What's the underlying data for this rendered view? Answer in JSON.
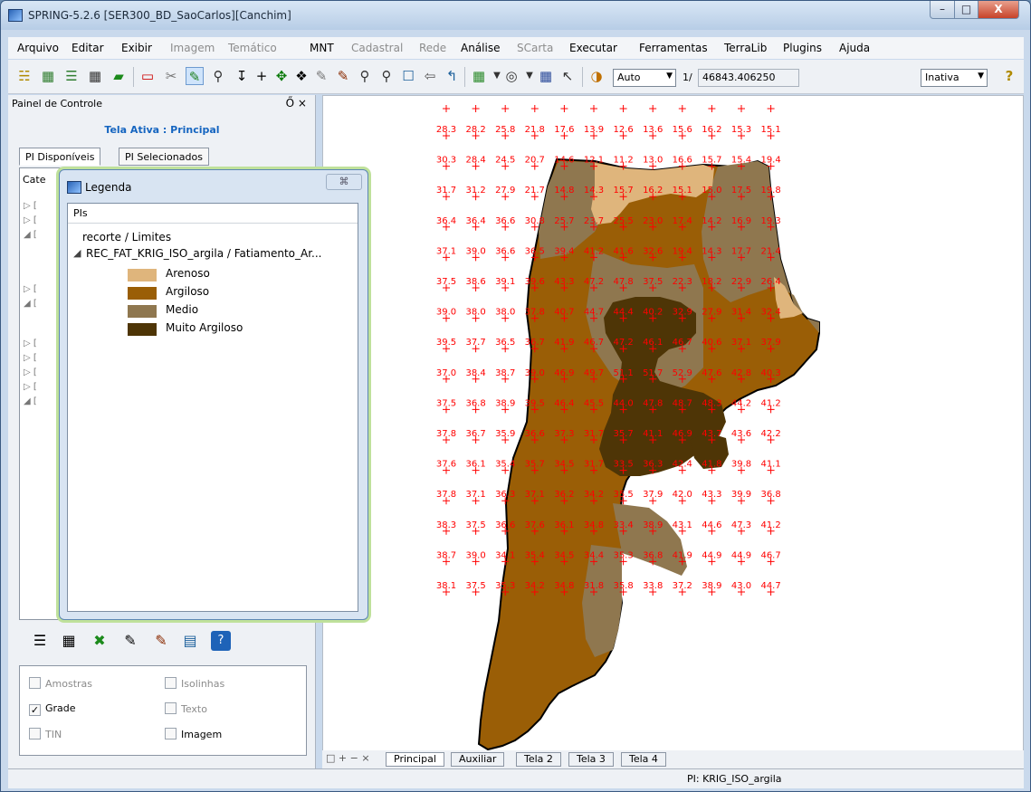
{
  "window": {
    "title": "SPRING-5.2.6 [SER300_BD_SaoCarlos][Canchim]",
    "min": "–",
    "max": "□",
    "close": "X"
  },
  "menu": [
    {
      "label": "Arquivo",
      "enabled": true
    },
    {
      "label": "Editar",
      "enabled": true
    },
    {
      "label": "Exibir",
      "enabled": true
    },
    {
      "label": "Imagem",
      "enabled": false
    },
    {
      "label": "Temático",
      "enabled": false
    },
    {
      "label": "MNT",
      "enabled": true
    },
    {
      "label": "Cadastral",
      "enabled": false
    },
    {
      "label": "Rede",
      "enabled": false
    },
    {
      "label": "Análise",
      "enabled": true
    },
    {
      "label": "SCarta",
      "enabled": false
    },
    {
      "label": "Executar",
      "enabled": true
    },
    {
      "label": "Ferramentas",
      "enabled": true
    },
    {
      "label": "TerraLib",
      "enabled": true
    },
    {
      "label": "Plugins",
      "enabled": true
    },
    {
      "label": "Ajuda",
      "enabled": true
    }
  ],
  "toolbar": {
    "zoom_mode": "Auto",
    "scale_prefix": "1/",
    "scale_value": "46843.406250",
    "state": "Inativa",
    "help": "?"
  },
  "panel": {
    "title": "Painel de Controle",
    "controls": "Ő ×",
    "tela_ativa": "Tela Ativa : Principal",
    "tabs": [
      "PI Disponíveis",
      "PI Selecionados"
    ],
    "category_label": "Cate"
  },
  "checks": [
    {
      "label": "Amostras",
      "checked": false,
      "enabled": false
    },
    {
      "label": "Isolinhas",
      "checked": false,
      "enabled": false
    },
    {
      "label": "Grade",
      "checked": true,
      "enabled": true
    },
    {
      "label": "Texto",
      "checked": false,
      "enabled": false
    },
    {
      "label": "TIN",
      "checked": false,
      "enabled": false
    },
    {
      "label": "Imagem",
      "checked": false,
      "enabled": true
    }
  ],
  "legend": {
    "title": "Legenda",
    "close": "⌘",
    "header": "PIs",
    "item_limits": "recorte / Limites",
    "item_slicing": "REC_FAT_KRIG_ISO_argila / Fatiamento_Ar...",
    "classes": [
      {
        "name": "Arenoso",
        "color": "#dfb57c"
      },
      {
        "name": "Argiloso",
        "color": "#9a5e06"
      },
      {
        "name": "Medio",
        "color": "#8f774f"
      },
      {
        "name": "Muito Argiloso",
        "color": "#4e3506"
      }
    ]
  },
  "bottom_tabs": [
    "Principal",
    "Auxiliar",
    "Tela 2",
    "Tela 3",
    "Tela 4"
  ],
  "bottom_ctrls": "□ + − ×",
  "status": {
    "pi": "PI: KRIG_ISO_argila"
  },
  "grid": {
    "rows": [
      [
        "28.3",
        "28.2",
        "25.8",
        "21.8",
        "17.6",
        "13.9",
        "12.6",
        "13.6",
        "15.6",
        "16.2",
        "15.3",
        "15.1"
      ],
      [
        "30.3",
        "28.4",
        "24.5",
        "20.7",
        "14.6",
        "12.1",
        "11.2",
        "13.0",
        "16.6",
        "15.7",
        "15.4",
        "19.4"
      ],
      [
        "31.7",
        "31.2",
        "27.9",
        "21.7",
        "14.8",
        "14.3",
        "15.7",
        "16.2",
        "15.1",
        "15.0",
        "17.5",
        "19.8"
      ],
      [
        "36.4",
        "36.4",
        "36.6",
        "30.8",
        "25.7",
        "23.7",
        "25.5",
        "23.0",
        "17.4",
        "14.2",
        "16.9",
        "19.3"
      ],
      [
        "37.1",
        "39.0",
        "36.6",
        "36.5",
        "39.4",
        "41.2",
        "41.6",
        "32.6",
        "19.4",
        "14.3",
        "17.7",
        "21.4"
      ],
      [
        "37.5",
        "38.6",
        "39.1",
        "39.6",
        "43.3",
        "47.2",
        "47.8",
        "37.5",
        "22.3",
        "18.2",
        "22.9",
        "26.4"
      ],
      [
        "39.0",
        "38.0",
        "38.0",
        "37.8",
        "40.7",
        "44.7",
        "44.4",
        "40.2",
        "32.9",
        "27.9",
        "31.4",
        "32.4"
      ],
      [
        "39.5",
        "37.7",
        "36.5",
        "36.7",
        "41.9",
        "46.7",
        "47.2",
        "46.1",
        "46.7",
        "40.6",
        "37.1",
        "37.9"
      ],
      [
        "37.0",
        "38.4",
        "38.7",
        "39.0",
        "46.9",
        "49.7",
        "51.1",
        "51.7",
        "52.9",
        "47.6",
        "42.8",
        "40.3"
      ],
      [
        "37.5",
        "36.8",
        "38.9",
        "39.5",
        "46.4",
        "45.5",
        "44.0",
        "47.8",
        "48.7",
        "48.3",
        "44.2",
        "41.2"
      ],
      [
        "37.8",
        "36.7",
        "35.9",
        "36.6",
        "37.3",
        "31.7",
        "35.7",
        "41.1",
        "46.9",
        "43.7",
        "43.6",
        "42.2"
      ],
      [
        "37.6",
        "36.1",
        "35.4",
        "35.7",
        "34.5",
        "31.7",
        "33.5",
        "36.3",
        "42.4",
        "41.8",
        "39.8",
        "41.1"
      ],
      [
        "37.8",
        "37.1",
        "36.3",
        "37.1",
        "36.2",
        "34.2",
        "35.5",
        "37.9",
        "42.0",
        "43.3",
        "39.9",
        "36.8"
      ],
      [
        "38.3",
        "37.5",
        "36.6",
        "37.6",
        "36.1",
        "34.8",
        "33.4",
        "38.9",
        "43.1",
        "44.6",
        "47.3",
        "41.2"
      ],
      [
        "38.7",
        "39.0",
        "34.1",
        "35.4",
        "34.5",
        "34.4",
        "35.3",
        "36.8",
        "41.9",
        "44.9",
        "44.9",
        "46.7"
      ],
      [
        "38.1",
        "37.5",
        "35.3",
        "34.2",
        "34.8",
        "31.8",
        "35.8",
        "33.8",
        "37.2",
        "38.9",
        "43.0",
        "44.7"
      ]
    ],
    "label_color": "#ff0000",
    "cross_color": "#ff0000"
  }
}
